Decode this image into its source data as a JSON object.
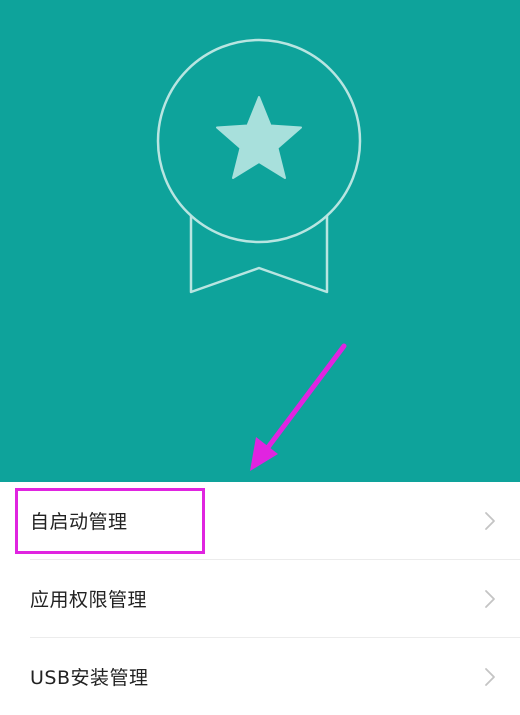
{
  "hero": {
    "accent": "#0ea39b"
  },
  "settings": {
    "items": [
      {
        "label": "自启动管理"
      },
      {
        "label": "应用权限管理"
      },
      {
        "label": "USB安装管理"
      }
    ]
  },
  "annotation": {
    "color": "#e024e0",
    "highlighted_item": "自启动管理"
  },
  "icons": {
    "chevron": "chevron-right-icon",
    "badge": "medal-star-icon"
  }
}
